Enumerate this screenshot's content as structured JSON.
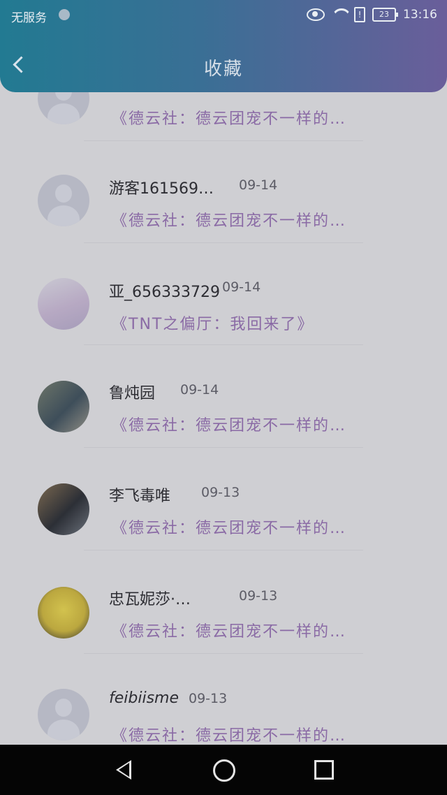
{
  "status_bar": {
    "carrier": "无服务",
    "battery": "23",
    "time": "13:16"
  },
  "header": {
    "title": "收藏"
  },
  "items": [
    {
      "name": "",
      "date": "",
      "excerpt": "《德云社：德云团宠不一样的…"
    },
    {
      "name": "游客161569…",
      "date": "09-14",
      "excerpt": "《德云社：德云团宠不一样的…"
    },
    {
      "name": "亚_656333729",
      "date": "09-14",
      "excerpt": "《TNT之偏厅：我回来了》"
    },
    {
      "name": "鲁炖园",
      "date": "09-14",
      "excerpt": "《德云社：德云团宠不一样的…"
    },
    {
      "name": "李飞毒唯",
      "date": "09-13",
      "excerpt": "《德云社：德云团宠不一样的…"
    },
    {
      "name": "忠瓦妮莎·…",
      "date": "09-13",
      "excerpt": "《德云社：德云团宠不一样的…"
    },
    {
      "name": "feibiisme",
      "date": "09-13",
      "excerpt": "《德云社：德云团宠不一样的…"
    }
  ],
  "icons": {
    "back": "chevron-left-icon",
    "nav_back": "triangle-back-icon",
    "nav_home": "circle-home-icon",
    "nav_recent": "square-recent-icon"
  }
}
